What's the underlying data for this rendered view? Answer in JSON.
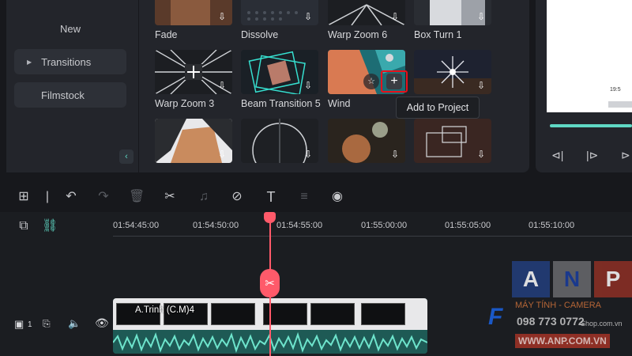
{
  "sidebar": {
    "items": [
      {
        "label": "New",
        "expandable": false,
        "highlighted": false
      },
      {
        "label": "Transitions",
        "expandable": true,
        "highlighted": true
      },
      {
        "label": "Filmstock",
        "expandable": false,
        "highlighted": true
      }
    ],
    "collapse_icon": "chevron-left-icon"
  },
  "transitions": [
    {
      "label": "Fade"
    },
    {
      "label": "Dissolve"
    },
    {
      "label": "Warp Zoom 6"
    },
    {
      "label": "Box Turn 1"
    },
    {
      "label": "Warp Zoom 3"
    },
    {
      "label": "Beam Transition 5"
    },
    {
      "label": "Wind"
    },
    {
      "label": ""
    }
  ],
  "tooltip": {
    "text": "Add to Project"
  },
  "add_button": {
    "symbol": "+"
  },
  "star_button": {
    "symbol": "☆"
  },
  "download_symbol": "⇩",
  "preview": {
    "screen_text": "19:5",
    "controls": [
      "⊲|",
      "|⊳",
      "⊳"
    ]
  },
  "toolbar": {
    "icons": [
      {
        "name": "layout-icon",
        "glyph": "⊞",
        "enabled": true
      },
      {
        "name": "divider",
        "glyph": "|",
        "enabled": true
      },
      {
        "name": "undo-icon",
        "glyph": "↶",
        "enabled": true
      },
      {
        "name": "redo-icon",
        "glyph": "↷",
        "enabled": false
      },
      {
        "name": "delete-icon",
        "glyph": "🗑",
        "enabled": false
      },
      {
        "name": "cut-icon",
        "glyph": "✂",
        "enabled": true
      },
      {
        "name": "audio-icon",
        "glyph": "♫",
        "enabled": false
      },
      {
        "name": "tag-icon",
        "glyph": "⊘",
        "enabled": true
      },
      {
        "name": "text-icon",
        "glyph": "T",
        "enabled": true
      },
      {
        "name": "adjust-icon",
        "glyph": "≡",
        "enabled": false
      },
      {
        "name": "voice-icon",
        "glyph": "◉",
        "enabled": true
      }
    ]
  },
  "timeline": {
    "ticks": [
      "01:54:45:00",
      "01:54:50:00",
      "01:54:55:00",
      "01:55:00:00",
      "01:55:05:00",
      "01:55:10:00"
    ],
    "clip_label": "A.Trinh (C.M)4",
    "track_number": "1",
    "add_track_icon": "add-track-icon",
    "link_icon": "link-icon"
  },
  "watermark": {
    "letters": [
      "A",
      "N",
      "P"
    ],
    "tagline": "MÁY TÍNH - CAMERA",
    "shop": "098 773 0772",
    "site": "WWW.ANP.COM.VN",
    "site2": "Shop.com.vn",
    "f_letter": "F"
  },
  "colors": {
    "accent": "#5fd8c4",
    "playhead": "#ff5a6a",
    "highlight_border": "#e8101b"
  }
}
